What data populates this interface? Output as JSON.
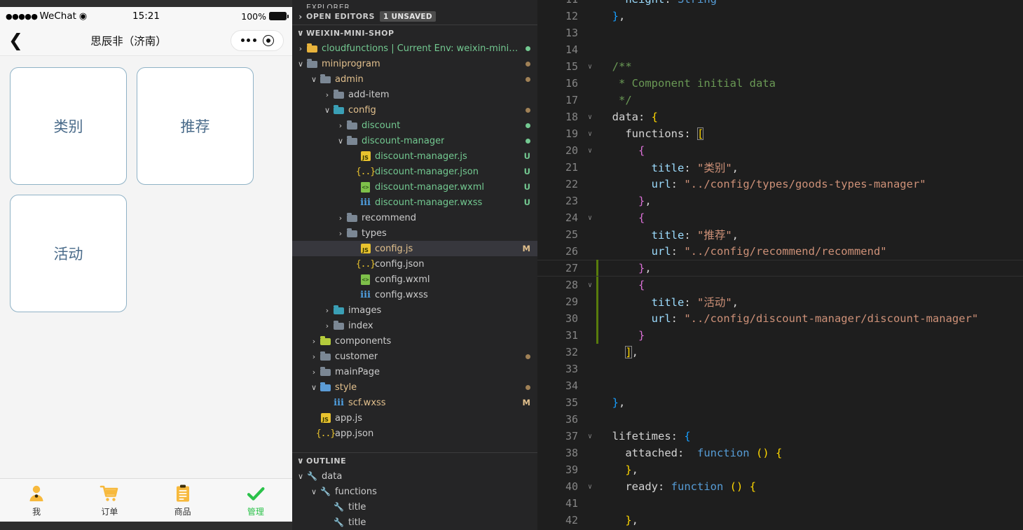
{
  "simulator": {
    "status_bar": {
      "signal_dots": "●●●●●",
      "carrier": "WeChat",
      "wifi_icon": "wifi-icon",
      "time": "15:21",
      "battery_percent": "100%"
    },
    "nav_bar": {
      "back_icon": "back-chevron-icon",
      "title": "思辰非（济南）",
      "capsule_more_icon": "more-dots-icon",
      "capsule_target_icon": "target-circle-icon"
    },
    "cards": [
      {
        "label": "类别"
      },
      {
        "label": "推荐"
      },
      {
        "label": "活动"
      }
    ],
    "tabs": [
      {
        "label": "我",
        "icon": "person-icon",
        "active": false
      },
      {
        "label": "订单",
        "icon": "cart-icon",
        "active": false
      },
      {
        "label": "商品",
        "icon": "clipboard-icon",
        "active": false
      },
      {
        "label": "管理",
        "icon": "check-icon",
        "active": true
      }
    ],
    "accent_color": "#2bc24a",
    "card_border_color": "#8fb2c6",
    "card_text_color": "#4a6b8a"
  },
  "sidebar": {
    "view_title": "EXPLORER",
    "open_editors": {
      "label": "OPEN EDITORS",
      "badge": "1 UNSAVED",
      "expanded": false
    },
    "project": {
      "label": "WEIXIN-MINI-SHOP",
      "expanded": true
    },
    "tree": [
      {
        "indent": 1,
        "twisty": "›",
        "icon": "folder-cloud-icon",
        "icon_class": "fold yellow",
        "label": "cloudfunctions | Current Env: weixin-mini-s…",
        "color": "c-green",
        "dot": "#73c991"
      },
      {
        "indent": 1,
        "twisty": "∨",
        "icon": "folder-open-icon",
        "icon_class": "fold open",
        "label": "miniprogram",
        "color": "c-mod",
        "dot": "#a08156"
      },
      {
        "indent": 2,
        "twisty": "∨",
        "icon": "folder-open-icon",
        "icon_class": "fold open",
        "label": "admin",
        "color": "c-mod",
        "dot": "#a08156"
      },
      {
        "indent": 3,
        "twisty": "›",
        "icon": "folder-icon",
        "icon_class": "fold",
        "label": "add-item",
        "color": "c-plain",
        "dot": ""
      },
      {
        "indent": 3,
        "twisty": "∨",
        "icon": "folder-config-icon",
        "icon_class": "fold teal",
        "label": "config",
        "color": "c-mod",
        "dot": "#a08156"
      },
      {
        "indent": 4,
        "twisty": "›",
        "icon": "folder-icon",
        "icon_class": "fold",
        "label": "discount",
        "color": "c-green",
        "dot": "#73c991"
      },
      {
        "indent": 4,
        "twisty": "∨",
        "icon": "folder-open-icon",
        "icon_class": "fold open",
        "label": "discount-manager",
        "color": "c-green",
        "dot": "#73c991"
      },
      {
        "indent": 5,
        "twisty": "",
        "icon": "js-file-icon",
        "icon_class": "js",
        "label": "discount-manager.js",
        "color": "c-green",
        "status": "U",
        "status_color": "c-green"
      },
      {
        "indent": 5,
        "twisty": "",
        "icon": "json-file-icon",
        "icon_class": "json",
        "label": "discount-manager.json",
        "color": "c-green",
        "status": "U",
        "status_color": "c-green"
      },
      {
        "indent": 5,
        "twisty": "",
        "icon": "wxml-file-icon",
        "icon_class": "wxml",
        "label": "discount-manager.wxml",
        "color": "c-green",
        "status": "U",
        "status_color": "c-green"
      },
      {
        "indent": 5,
        "twisty": "",
        "icon": "wxss-file-icon",
        "icon_class": "wxss",
        "label": "discount-manager.wxss",
        "color": "c-green",
        "status": "U",
        "status_color": "c-green"
      },
      {
        "indent": 4,
        "twisty": "›",
        "icon": "folder-icon",
        "icon_class": "fold",
        "label": "recommend",
        "color": "c-plain",
        "dot": ""
      },
      {
        "indent": 4,
        "twisty": "›",
        "icon": "folder-icon",
        "icon_class": "fold",
        "label": "types",
        "color": "c-plain",
        "dot": ""
      },
      {
        "indent": 5,
        "twisty": "",
        "icon": "js-file-icon",
        "icon_class": "js",
        "label": "config.js",
        "color": "c-mod",
        "status": "M",
        "status_color": "c-mod",
        "selected": true
      },
      {
        "indent": 5,
        "twisty": "",
        "icon": "json-file-icon",
        "icon_class": "json",
        "label": "config.json",
        "color": "c-plain",
        "status": ""
      },
      {
        "indent": 5,
        "twisty": "",
        "icon": "wxml-file-icon",
        "icon_class": "wxml",
        "label": "config.wxml",
        "color": "c-plain",
        "status": ""
      },
      {
        "indent": 5,
        "twisty": "",
        "icon": "wxss-file-icon",
        "icon_class": "wxss",
        "label": "config.wxss",
        "color": "c-plain",
        "status": ""
      },
      {
        "indent": 3,
        "twisty": "›",
        "icon": "folder-images-icon",
        "icon_class": "fold teal",
        "label": "images",
        "color": "c-plain",
        "dot": ""
      },
      {
        "indent": 3,
        "twisty": "›",
        "icon": "folder-icon",
        "icon_class": "fold",
        "label": "index",
        "color": "c-plain",
        "dot": ""
      },
      {
        "indent": 2,
        "twisty": "›",
        "icon": "folder-components-icon",
        "icon_class": "fold lime",
        "label": "components",
        "color": "c-plain",
        "dot": ""
      },
      {
        "indent": 2,
        "twisty": "›",
        "icon": "folder-icon",
        "icon_class": "fold",
        "label": "customer",
        "color": "c-plain",
        "dot": "#a08156"
      },
      {
        "indent": 2,
        "twisty": "›",
        "icon": "folder-icon",
        "icon_class": "fold",
        "label": "mainPage",
        "color": "c-plain",
        "dot": ""
      },
      {
        "indent": 2,
        "twisty": "∨",
        "icon": "folder-style-icon",
        "icon_class": "fold blue",
        "label": "style",
        "color": "c-mod",
        "dot": "#a08156"
      },
      {
        "indent": 3,
        "twisty": "",
        "icon": "wxss-file-icon",
        "icon_class": "wxss",
        "label": "scf.wxss",
        "color": "c-mod",
        "status": "M",
        "status_color": "c-mod"
      },
      {
        "indent": 2,
        "twisty": "",
        "icon": "js-file-icon",
        "icon_class": "js",
        "label": "app.js",
        "color": "c-plain",
        "status": ""
      },
      {
        "indent": 2,
        "twisty": "",
        "icon": "json-file-icon",
        "icon_class": "json",
        "label": "app.json",
        "color": "c-plain",
        "status": ""
      }
    ],
    "outline": {
      "label": "OUTLINE",
      "items": [
        {
          "indent": 1,
          "twisty": "∨",
          "icon": "property-wrench-icon",
          "label": "data"
        },
        {
          "indent": 2,
          "twisty": "∨",
          "icon": "property-wrench-icon",
          "label": "functions"
        },
        {
          "indent": 3,
          "twisty": "",
          "icon": "property-wrench-icon",
          "label": "title"
        },
        {
          "indent": 3,
          "twisty": "",
          "icon": "property-wrench-icon",
          "label": "title"
        }
      ]
    }
  },
  "editor": {
    "lines": [
      {
        "num": "11",
        "fold": "",
        "change": false,
        "current": false,
        "tokens": [
          {
            "t": "    ",
            "c": "ind"
          },
          {
            "t": "height",
            "c": "k-prop"
          },
          {
            "t": ": ",
            "c": "k-white"
          },
          {
            "t": "String",
            "c": "k-blue"
          }
        ]
      },
      {
        "num": "12",
        "fold": "",
        "change": false,
        "current": false,
        "tokens": [
          {
            "t": "  ",
            "c": "ind"
          },
          {
            "t": "}",
            "c": "k-brace3"
          },
          {
            "t": ",",
            "c": "k-white"
          }
        ]
      },
      {
        "num": "13",
        "fold": "",
        "change": false,
        "current": false,
        "tokens": []
      },
      {
        "num": "14",
        "fold": "",
        "change": false,
        "current": false,
        "tokens": []
      },
      {
        "num": "15",
        "fold": "∨",
        "change": false,
        "current": false,
        "tokens": [
          {
            "t": "  ",
            "c": "ind"
          },
          {
            "t": "/**",
            "c": "k-com"
          }
        ]
      },
      {
        "num": "16",
        "fold": "",
        "change": false,
        "current": false,
        "tokens": [
          {
            "t": "   ",
            "c": "ind"
          },
          {
            "t": "* Component initial data",
            "c": "k-com"
          }
        ]
      },
      {
        "num": "17",
        "fold": "",
        "change": false,
        "current": false,
        "tokens": [
          {
            "t": "   ",
            "c": "ind"
          },
          {
            "t": "*/",
            "c": "k-com"
          }
        ]
      },
      {
        "num": "18",
        "fold": "∨",
        "change": false,
        "current": false,
        "tokens": [
          {
            "t": "  ",
            "c": "ind"
          },
          {
            "t": "data",
            "c": "k-white"
          },
          {
            "t": ": ",
            "c": "k-white"
          },
          {
            "t": "{",
            "c": "k-brace1"
          }
        ]
      },
      {
        "num": "19",
        "fold": "∨",
        "change": false,
        "current": false,
        "tokens": [
          {
            "t": "    ",
            "c": "ind"
          },
          {
            "t": "functions",
            "c": "k-white"
          },
          {
            "t": ": ",
            "c": "k-white"
          },
          {
            "t": "[",
            "c": "k-brace1 brk-match"
          }
        ]
      },
      {
        "num": "20",
        "fold": "∨",
        "change": false,
        "current": false,
        "tokens": [
          {
            "t": "      ",
            "c": "ind"
          },
          {
            "t": "{",
            "c": "k-brace2"
          }
        ]
      },
      {
        "num": "21",
        "fold": "",
        "change": false,
        "current": false,
        "tokens": [
          {
            "t": "        ",
            "c": "ind"
          },
          {
            "t": "title",
            "c": "k-prop"
          },
          {
            "t": ": ",
            "c": "k-white"
          },
          {
            "t": "\"类别\"",
            "c": "k-str"
          },
          {
            "t": ",",
            "c": "k-white"
          }
        ]
      },
      {
        "num": "22",
        "fold": "",
        "change": false,
        "current": false,
        "tokens": [
          {
            "t": "        ",
            "c": "ind"
          },
          {
            "t": "url",
            "c": "k-prop"
          },
          {
            "t": ": ",
            "c": "k-white"
          },
          {
            "t": "\"../config/types/goods-types-manager\"",
            "c": "k-str"
          }
        ]
      },
      {
        "num": "23",
        "fold": "",
        "change": false,
        "current": false,
        "tokens": [
          {
            "t": "      ",
            "c": "ind"
          },
          {
            "t": "}",
            "c": "k-brace2"
          },
          {
            "t": ",",
            "c": "k-white"
          }
        ]
      },
      {
        "num": "24",
        "fold": "∨",
        "change": false,
        "current": false,
        "tokens": [
          {
            "t": "      ",
            "c": "ind"
          },
          {
            "t": "{",
            "c": "k-brace2"
          }
        ]
      },
      {
        "num": "25",
        "fold": "",
        "change": false,
        "current": false,
        "tokens": [
          {
            "t": "        ",
            "c": "ind"
          },
          {
            "t": "title",
            "c": "k-prop"
          },
          {
            "t": ": ",
            "c": "k-white"
          },
          {
            "t": "\"推荐\"",
            "c": "k-str"
          },
          {
            "t": ",",
            "c": "k-white"
          }
        ]
      },
      {
        "num": "26",
        "fold": "",
        "change": false,
        "current": false,
        "tokens": [
          {
            "t": "        ",
            "c": "ind"
          },
          {
            "t": "url",
            "c": "k-prop"
          },
          {
            "t": ": ",
            "c": "k-white"
          },
          {
            "t": "\"../config/recommend/recommend\"",
            "c": "k-str"
          }
        ]
      },
      {
        "num": "27",
        "fold": "",
        "change": true,
        "current": true,
        "tokens": [
          {
            "t": "      ",
            "c": "ind"
          },
          {
            "t": "}",
            "c": "k-brace2"
          },
          {
            "t": ",",
            "c": "k-white"
          }
        ]
      },
      {
        "num": "28",
        "fold": "∨",
        "change": true,
        "current": false,
        "tokens": [
          {
            "t": "      ",
            "c": "ind"
          },
          {
            "t": "{",
            "c": "k-brace2"
          }
        ]
      },
      {
        "num": "29",
        "fold": "",
        "change": true,
        "current": false,
        "tokens": [
          {
            "t": "        ",
            "c": "ind"
          },
          {
            "t": "title",
            "c": "k-prop"
          },
          {
            "t": ": ",
            "c": "k-white"
          },
          {
            "t": "\"活动\"",
            "c": "k-str"
          },
          {
            "t": ",",
            "c": "k-white"
          }
        ]
      },
      {
        "num": "30",
        "fold": "",
        "change": true,
        "current": false,
        "tokens": [
          {
            "t": "        ",
            "c": "ind"
          },
          {
            "t": "url",
            "c": "k-prop"
          },
          {
            "t": ": ",
            "c": "k-white"
          },
          {
            "t": "\"../config/discount-manager/discount-manager\"",
            "c": "k-str"
          }
        ]
      },
      {
        "num": "31",
        "fold": "",
        "change": true,
        "current": false,
        "tokens": [
          {
            "t": "      ",
            "c": "ind"
          },
          {
            "t": "}",
            "c": "k-brace2"
          }
        ]
      },
      {
        "num": "32",
        "fold": "",
        "change": false,
        "current": false,
        "tokens": [
          {
            "t": "    ",
            "c": "ind"
          },
          {
            "t": "]",
            "c": "k-brace1 brk-match"
          },
          {
            "t": ",",
            "c": "k-white"
          }
        ]
      },
      {
        "num": "33",
        "fold": "",
        "change": false,
        "current": false,
        "tokens": []
      },
      {
        "num": "34",
        "fold": "",
        "change": false,
        "current": false,
        "tokens": []
      },
      {
        "num": "35",
        "fold": "",
        "change": false,
        "current": false,
        "tokens": [
          {
            "t": "  ",
            "c": "ind"
          },
          {
            "t": "}",
            "c": "k-brace3"
          },
          {
            "t": ",",
            "c": "k-white"
          }
        ]
      },
      {
        "num": "36",
        "fold": "",
        "change": false,
        "current": false,
        "tokens": []
      },
      {
        "num": "37",
        "fold": "∨",
        "change": false,
        "current": false,
        "tokens": [
          {
            "t": "  ",
            "c": "ind"
          },
          {
            "t": "lifetimes",
            "c": "k-white"
          },
          {
            "t": ": ",
            "c": "k-white"
          },
          {
            "t": "{",
            "c": "k-brace3"
          }
        ]
      },
      {
        "num": "38",
        "fold": "",
        "change": false,
        "current": false,
        "tokens": [
          {
            "t": "    ",
            "c": "ind"
          },
          {
            "t": "attached",
            "c": "k-white"
          },
          {
            "t": ":  ",
            "c": "k-white"
          },
          {
            "t": "function",
            "c": "k-kw"
          },
          {
            "t": " ",
            "c": "k-white"
          },
          {
            "t": "()",
            "c": "k-brace1"
          },
          {
            "t": " ",
            "c": "k-white"
          },
          {
            "t": "{",
            "c": "k-brace1"
          }
        ]
      },
      {
        "num": "39",
        "fold": "",
        "change": false,
        "current": false,
        "tokens": [
          {
            "t": "    ",
            "c": "ind"
          },
          {
            "t": "}",
            "c": "k-brace1"
          },
          {
            "t": ",",
            "c": "k-white"
          }
        ]
      },
      {
        "num": "40",
        "fold": "∨",
        "change": false,
        "current": false,
        "tokens": [
          {
            "t": "    ",
            "c": "ind"
          },
          {
            "t": "ready",
            "c": "k-white"
          },
          {
            "t": ": ",
            "c": "k-white"
          },
          {
            "t": "function",
            "c": "k-kw"
          },
          {
            "t": " ",
            "c": "k-white"
          },
          {
            "t": "()",
            "c": "k-brace1"
          },
          {
            "t": " ",
            "c": "k-white"
          },
          {
            "t": "{",
            "c": "k-brace1"
          }
        ]
      },
      {
        "num": "41",
        "fold": "",
        "change": false,
        "current": false,
        "tokens": []
      },
      {
        "num": "42",
        "fold": "",
        "change": false,
        "current": false,
        "tokens": [
          {
            "t": "    ",
            "c": "ind"
          },
          {
            "t": "}",
            "c": "k-brace1"
          },
          {
            "t": ",",
            "c": "k-white"
          }
        ]
      }
    ]
  }
}
